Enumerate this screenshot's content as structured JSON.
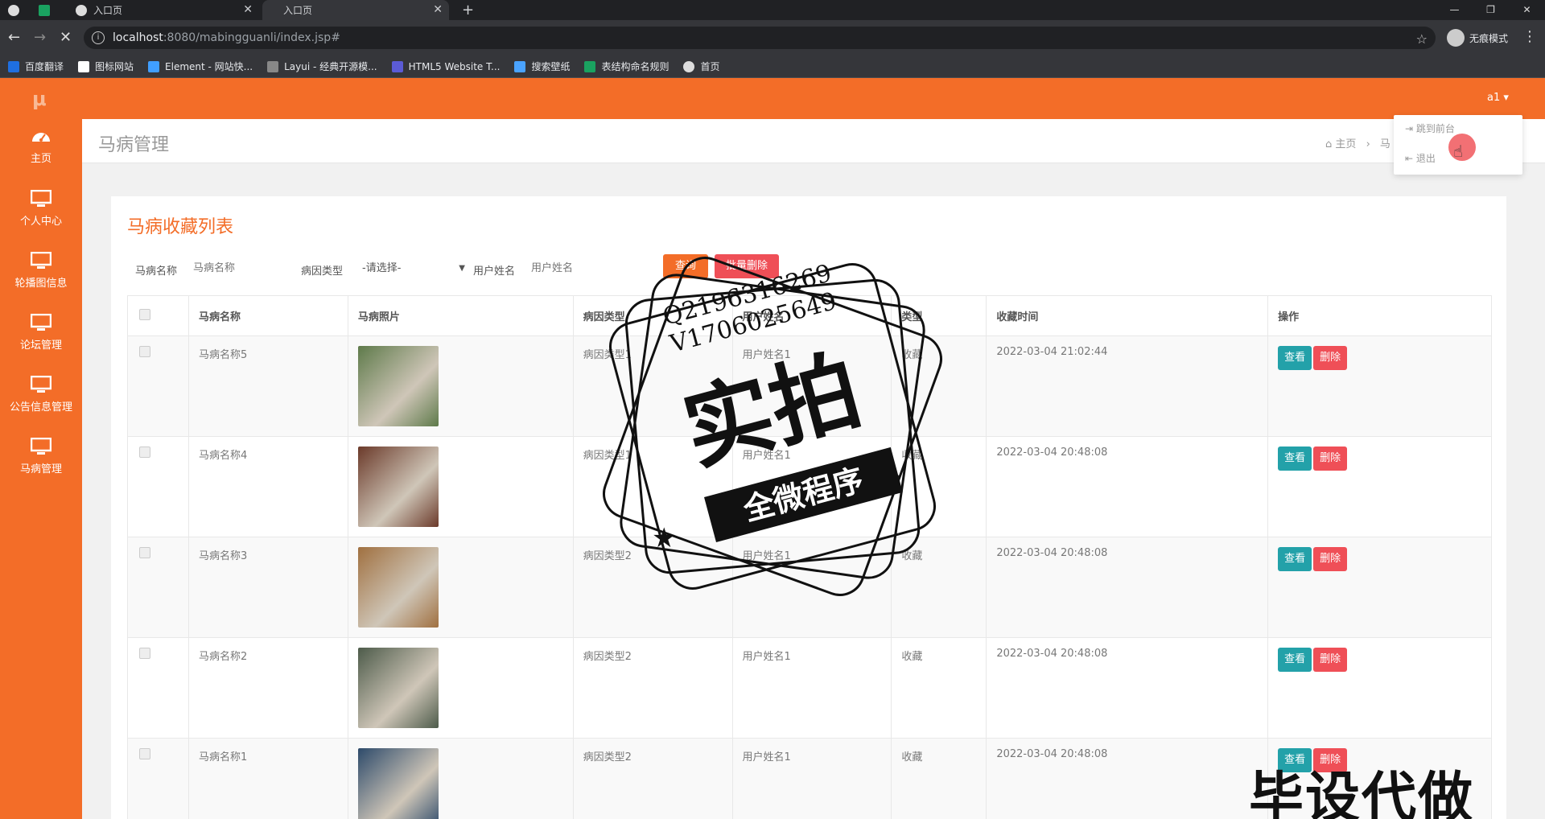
{
  "browser": {
    "tabs": [
      {
        "label": ""
      },
      {
        "label": ""
      },
      {
        "label": "入口页"
      },
      {
        "label": "入口页"
      }
    ],
    "url_host": "localhost",
    "url_path": ":8080/mabingguanli/index.jsp#",
    "incognito_label": "无痕模式",
    "bookmarks": [
      {
        "label": "百度翻译",
        "color": "#1f6fe0"
      },
      {
        "label": "图标网站",
        "color": "#ffffff"
      },
      {
        "label": "Element - 网站快...",
        "color": "#409eff"
      },
      {
        "label": "Layui - 经典开源模...",
        "color": "#cccccc"
      },
      {
        "label": "HTML5 Website T...",
        "color": "#5b5bd6"
      },
      {
        "label": "搜索壁纸",
        "color": "#4aa3ff"
      },
      {
        "label": "表结构命名规则",
        "color": "#1aa260"
      },
      {
        "label": "首页",
        "color": "#dddddd"
      }
    ]
  },
  "app": {
    "user": "a1",
    "accent": "#f36d28",
    "sidebar": [
      {
        "label": "主页",
        "icon": "dashboard-icon"
      },
      {
        "label": "个人中心",
        "icon": "monitor-icon"
      },
      {
        "label": "轮播图信息",
        "icon": "monitor-icon"
      },
      {
        "label": "论坛管理",
        "icon": "monitor-icon"
      },
      {
        "label": "公告信息管理",
        "icon": "monitor-icon"
      },
      {
        "label": "马病管理",
        "icon": "monitor-icon"
      }
    ],
    "page_title": "马病管理",
    "breadcrumb_home": "主页",
    "breadcrumb_sep": "›",
    "breadcrumb_cut": "马",
    "dropdown": [
      {
        "label": "跳到前台"
      },
      {
        "label": "退出"
      }
    ],
    "card_title": "马病收藏列表",
    "filters": {
      "name_label": "马病名称",
      "name_placeholder": "马病名称",
      "type_label": "病因类型",
      "type_selected": "-请选择-",
      "user_label": "用户姓名",
      "user_placeholder": "用户姓名",
      "search_button": "查询",
      "batch_delete_button": "批量删除"
    },
    "columns": [
      "马病名称",
      "马病照片",
      "病因类型",
      "用户姓名",
      "类型",
      "收藏时间",
      "操作"
    ],
    "rows": [
      {
        "name": "马病名称5",
        "type": "病因类型1",
        "user": "用户姓名1",
        "kind": "收藏",
        "time": "2022-03-04 21:02:44",
        "photo_color": "#5e7a4a"
      },
      {
        "name": "马病名称4",
        "type": "病因类型1",
        "user": "用户姓名1",
        "kind": "收藏",
        "time": "2022-03-04 20:48:08",
        "photo_color": "#6b3a2a"
      },
      {
        "name": "马病名称3",
        "type": "病因类型2",
        "user": "用户姓名1",
        "kind": "收藏",
        "time": "2022-03-04 20:48:08",
        "photo_color": "#a07040"
      },
      {
        "name": "马病名称2",
        "type": "病因类型2",
        "user": "用户姓名1",
        "kind": "收藏",
        "time": "2022-03-04 20:48:08",
        "photo_color": "#4d5b4a"
      },
      {
        "name": "马病名称1",
        "type": "病因类型2",
        "user": "用户姓名1",
        "kind": "收藏",
        "time": "2022-03-04 20:48:08",
        "photo_color": "#2d4a6a"
      }
    ],
    "view_button": "查看",
    "delete_button": "删除"
  },
  "watermark": {
    "contact_q": "Q2196316269",
    "contact_v": "V1706025649",
    "big_text": "实拍",
    "banner_text": "全微程序",
    "corner_text": "毕设代做"
  }
}
